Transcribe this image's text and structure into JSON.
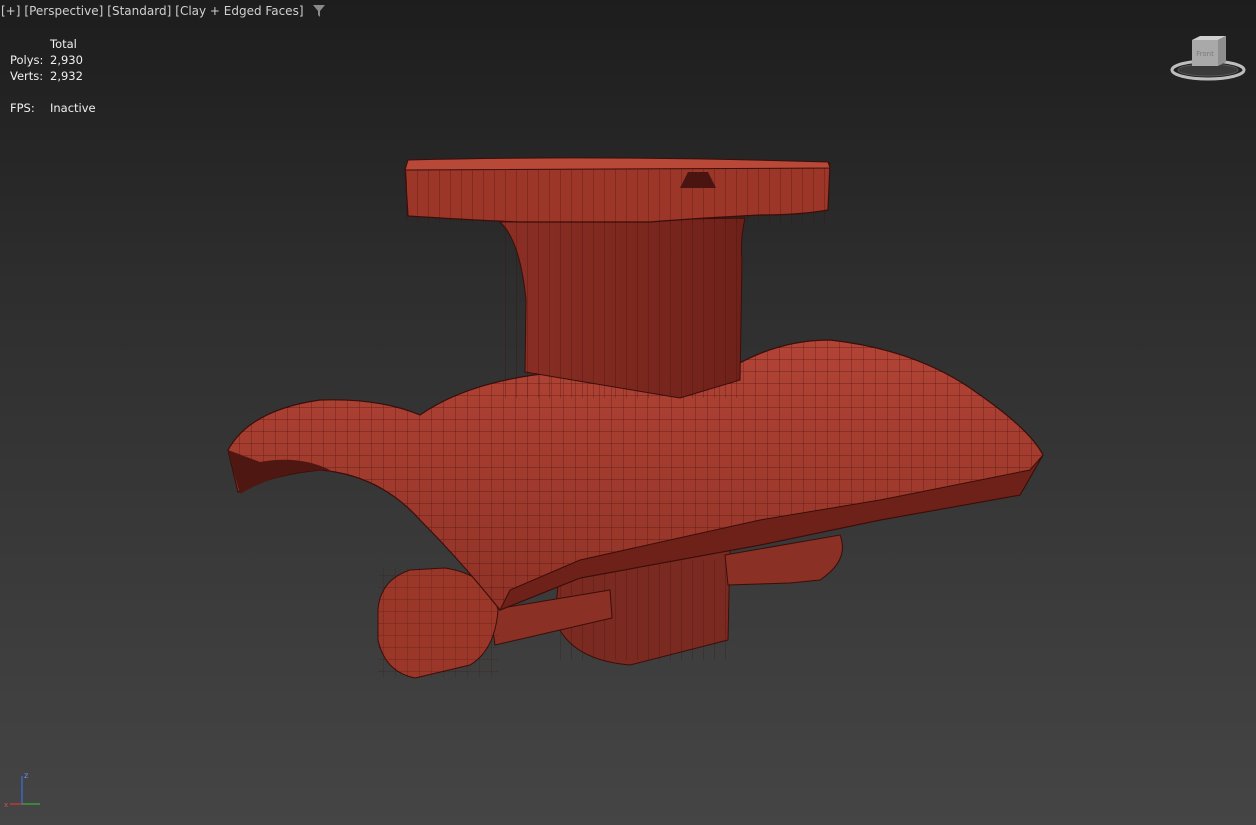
{
  "viewport": {
    "menu_plus": "[+]",
    "view_mode": "[Perspective]",
    "shading_preset": "[Standard]",
    "shading_mode": "[Clay + Edged Faces]"
  },
  "stats": {
    "header": "Total",
    "polys_label": "Polys:",
    "polys_value": "2,930",
    "verts_label": "Verts:",
    "verts_value": "2,932",
    "fps_label": "FPS:",
    "fps_value": "Inactive"
  },
  "viewcube": {
    "face_label": "Front"
  },
  "axis_gizmo": {
    "z": "z",
    "x": "x"
  },
  "colors": {
    "clay": "#a23a2e",
    "clay_dark": "#5a1d16",
    "edge": "#3a0e0a",
    "background_top": "#1d1d1d",
    "background_bottom": "#454545"
  }
}
